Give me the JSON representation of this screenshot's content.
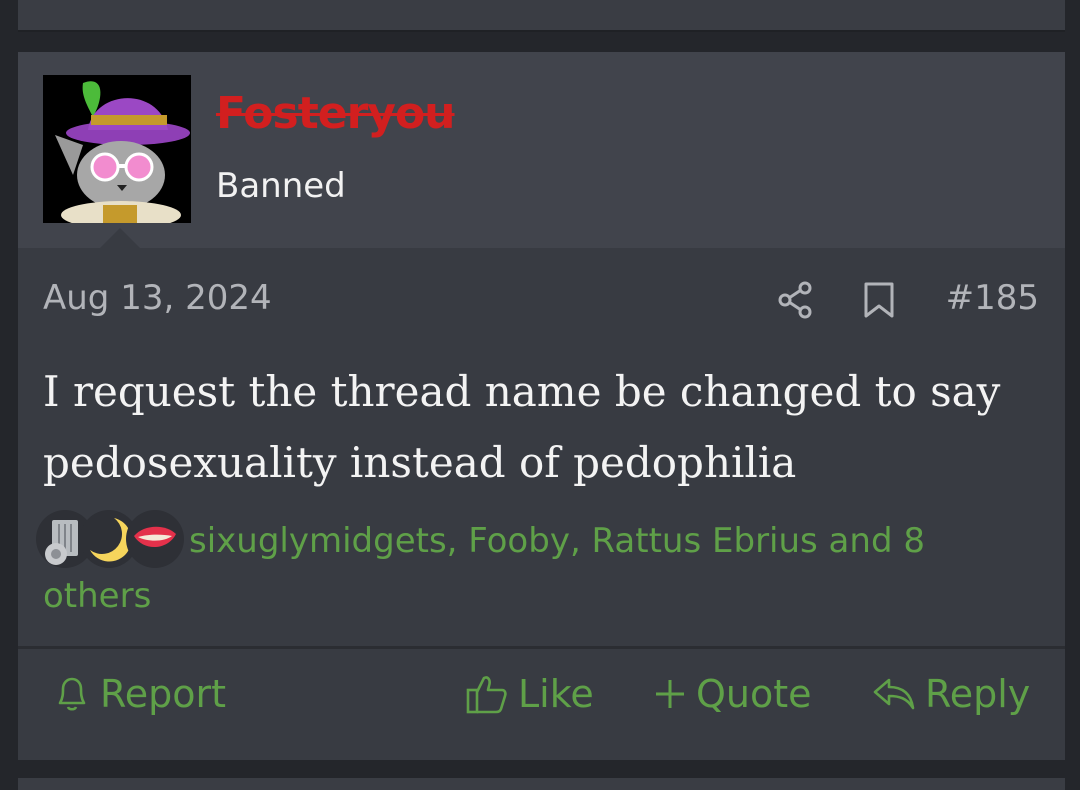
{
  "post": {
    "user": {
      "name": "Fosteryou",
      "title": "Banned"
    },
    "date": "Aug 13, 2024",
    "number": "#185",
    "message": "I request the thread name be changed to say pedosexuality instead of pedophilia",
    "reactions_text": "sixuglymidgets, Fooby, Rattus Ebrius and 8 others",
    "actions": {
      "report": "Report",
      "like": "Like",
      "quote": "Quote",
      "reply": "Reply"
    }
  },
  "colors": {
    "background": "#24262b",
    "post_bg": "#383b42",
    "header_bg": "#41444c",
    "accent_green": "#5fa048",
    "banned_red": "#d21f1f"
  },
  "icons": {
    "share": "share-icon",
    "bookmark": "bookmark-icon",
    "report": "bell-icon",
    "like": "thumbs-up-icon",
    "quote": "plus-icon",
    "reply": "reply-arrow-icon",
    "reaction_1": "trash-can-icon",
    "reaction_2": "crescent-moon-icon",
    "reaction_3": "lips-icon"
  }
}
